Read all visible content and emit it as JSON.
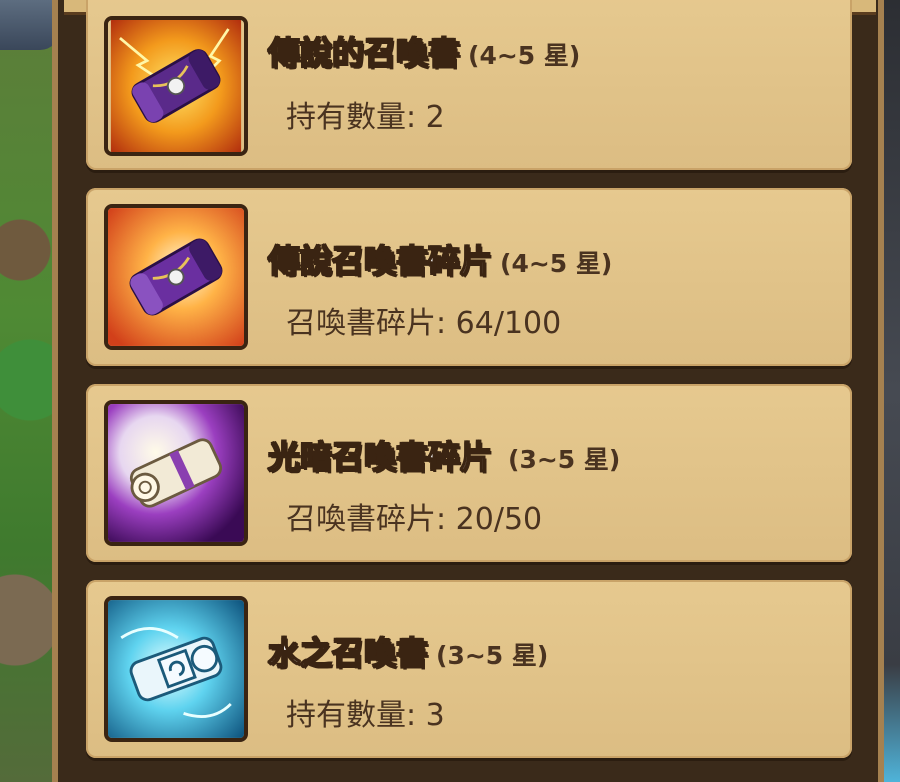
{
  "items": [
    {
      "name": "傳說的召喚書",
      "stars": "(4~5 星)",
      "detail_label": "持有數量",
      "detail_value": "2",
      "icon": "legendary-scroll-icon"
    },
    {
      "name": "傳說召喚書碎片",
      "stars": "(4~5 星)",
      "detail_label": "召喚書碎片",
      "detail_value": "64/100",
      "icon": "legendary-scroll-piece-icon"
    },
    {
      "name": "光暗召喚書碎片",
      "stars": "(3~5 星)",
      "detail_label": "召喚書碎片",
      "detail_value": "20/50",
      "icon": "light-dark-scroll-piece-icon"
    },
    {
      "name": "水之召喚書",
      "stars": "(3~5 星)",
      "detail_label": "持有數量",
      "detail_value": "3",
      "icon": "water-scroll-icon"
    }
  ],
  "colors": {
    "card_bg": "#e6c98f",
    "frame": "#3a2a1a",
    "title_outline": "#3a2412",
    "text_dark": "#4a3320"
  }
}
